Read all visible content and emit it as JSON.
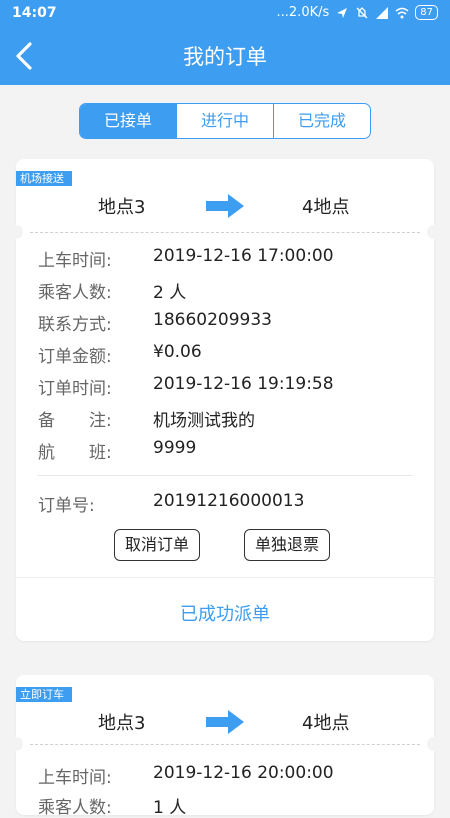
{
  "statusbar": {
    "time": "14:07",
    "network_speed": "...2.0K/s",
    "battery": "87",
    "icons": [
      "location-icon",
      "mute-icon",
      "signal-icon",
      "wifi-icon",
      "battery-icon"
    ]
  },
  "header": {
    "title": "我的订单",
    "back_icon": "back-arrow-icon"
  },
  "tabs": [
    {
      "label": "已接单",
      "active": true
    },
    {
      "label": "进行中",
      "active": false
    },
    {
      "label": "已完成",
      "active": false
    }
  ],
  "orders": [
    {
      "tag": "机场接送",
      "from": "地点3",
      "to": "4地点",
      "fields": [
        {
          "label": "上车时间:",
          "value": "2019-12-16 17:00:00"
        },
        {
          "label": "乘客人数:",
          "value": "2 人"
        },
        {
          "label": "联系方式:",
          "value": "18660209933"
        },
        {
          "label": "订单金额:",
          "value": "¥0.06"
        },
        {
          "label": "订单时间:",
          "value": "2019-12-16 19:19:58"
        },
        {
          "label": "备　　注:",
          "value": "机场测试我的"
        },
        {
          "label": "航　　班:",
          "value": "9999"
        }
      ],
      "order_no_label": "订单号:",
      "order_no": "20191216000013",
      "cancel_label": "取消订单",
      "refund_label": "单独退票",
      "status": "已成功派单"
    },
    {
      "tag": "立即订车",
      "from": "地点3",
      "to": "4地点",
      "fields": [
        {
          "label": "上车时间:",
          "value": "2019-12-16 20:00:00"
        },
        {
          "label": "乘客人数:",
          "value": "1 人"
        }
      ]
    }
  ],
  "colors": {
    "accent": "#3d9df0",
    "background": "#f3f3f3"
  }
}
